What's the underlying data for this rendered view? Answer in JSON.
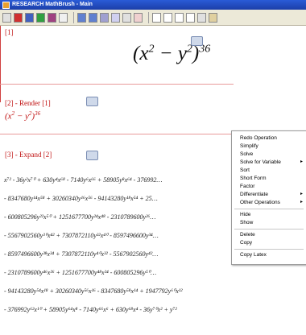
{
  "window": {
    "title": "RESEARCH MathBrush - Main"
  },
  "cells": [
    {
      "label": "[1]"
    },
    {
      "label": "[2] - Render  [1]"
    },
    {
      "label": "[3] - Expand  [2]"
    }
  ],
  "expression": {
    "base_x": "x",
    "exp_x": "2",
    "minus": "−",
    "base_y": "y",
    "exp_y": "2",
    "outer_exp": "36"
  },
  "expansion_rows": [
    "x⁷² - 36y²x⁷⁰ + 630y⁴x⁶⁸ - 7140y⁶x⁶⁶ + 58905y⁸x⁶⁴ - 376992…",
    "- 8347680y¹⁴x⁵⁸ + 30260340y¹⁶x⁵⁶ - 94143280y¹⁸x⁵⁴ + 25…",
    "- 600805296y²²x⁵⁰ + 1251677700y²⁴x⁴⁸ - 2310789600y²⁶…",
    "- 5567902560y³⁰x⁴² + 7307872110y³²x⁴⁰ - 8597496600y³⁴…",
    "- 8597496600y³⁸x³⁴ + 7307872110y⁴⁰x³² - 5567902560y⁴²…",
    "- 2310789600y⁴⁶x²⁶ + 1251677700y⁴⁸x²⁴ - 600805296y⁵⁰…",
    "- 94143280y⁵⁴x¹⁸ + 30260340y⁵⁶x¹⁶ - 8347680y⁵⁸x¹⁴ + 1947792y⁶⁰x¹²",
    "- 376992y⁶²x¹⁰ + 58905y⁶⁴x⁸ - 7140y⁶⁶x⁶ + 630y⁶⁸x⁴ - 36y⁷⁰x² + y⁷²"
  ],
  "context_menu": {
    "items": [
      {
        "label": "Redo Operation",
        "submenu": false
      },
      {
        "label": "Simplify",
        "submenu": false
      },
      {
        "label": "Solve",
        "submenu": false
      },
      {
        "label": "Solve for Variable",
        "submenu": true
      },
      {
        "label": "Sort",
        "submenu": false
      },
      {
        "label": "Short Form",
        "submenu": false
      },
      {
        "label": "Factor",
        "submenu": false
      },
      {
        "label": "Differentiate",
        "submenu": true
      },
      {
        "label": "Other Operations",
        "submenu": true
      },
      {
        "label": "Hide",
        "submenu": false
      },
      {
        "label": "Show",
        "submenu": false
      },
      {
        "label": "Delete",
        "submenu": false
      },
      {
        "label": "Copy",
        "submenu": false
      },
      {
        "label": "Copy Latex",
        "submenu": false
      }
    ],
    "submenu_arrow": "▸"
  },
  "colors": {
    "accent_red": "#c01010",
    "titlebar": "#1c3fa8"
  }
}
